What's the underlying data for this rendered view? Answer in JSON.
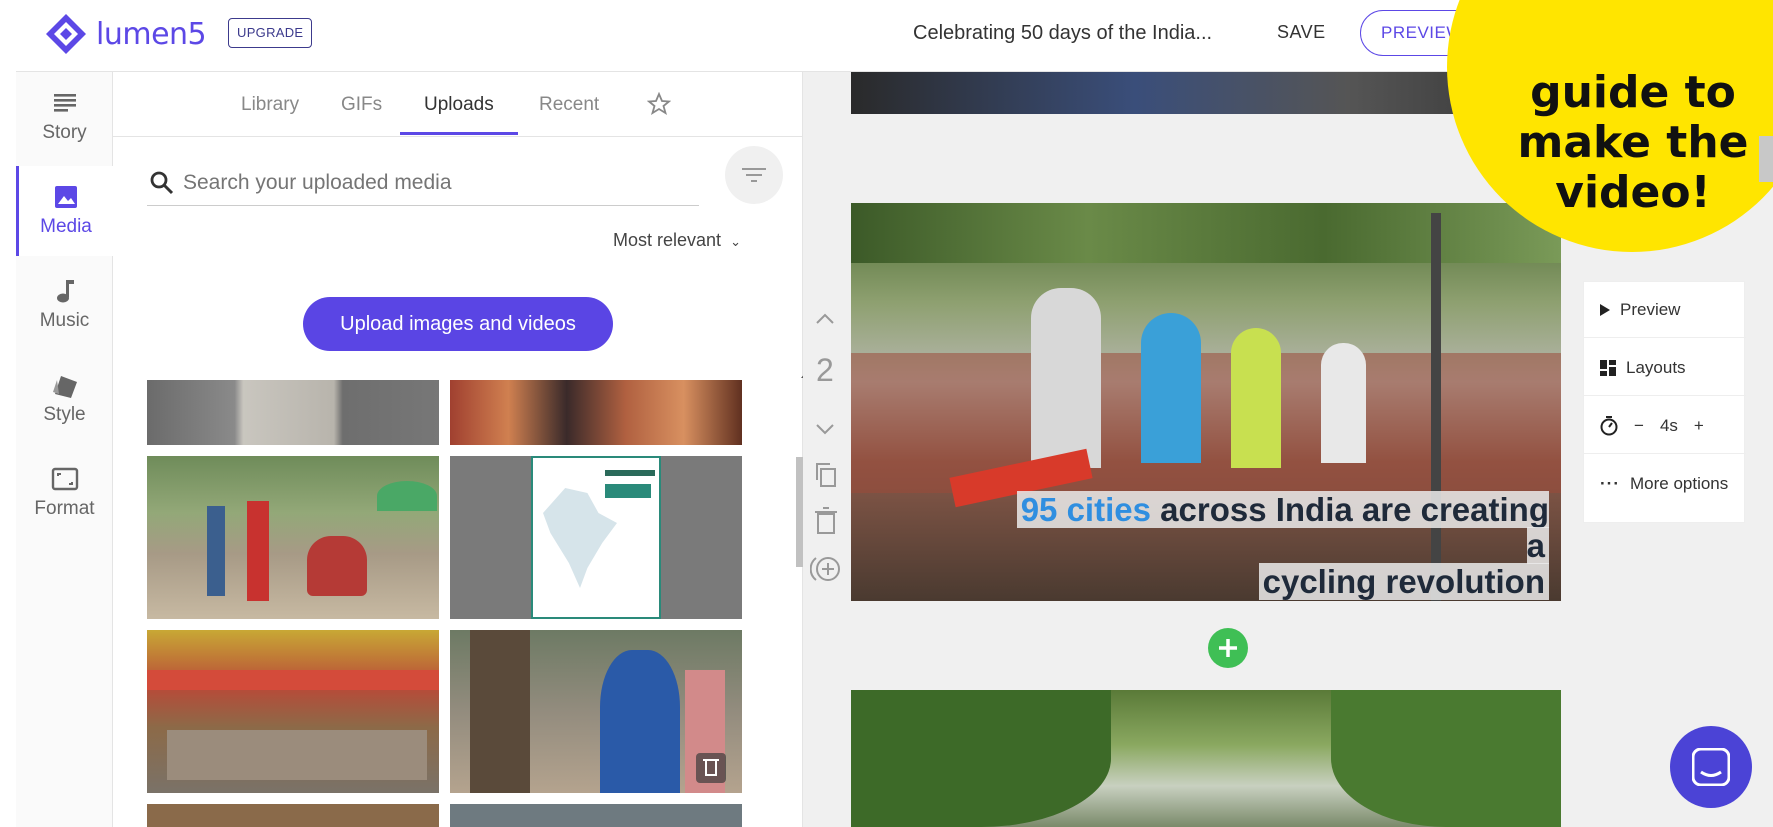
{
  "brand": {
    "name": "lumen5",
    "upgrade_label": "UPGRADE",
    "accent": "#5c48e6"
  },
  "header": {
    "project_title": "Celebrating 50 days of the India...",
    "save_label": "SAVE",
    "preview_label": "PREVIEW"
  },
  "sticker": {
    "text": "guide to make the video!",
    "color": "#ffe500"
  },
  "sidebar": {
    "items": [
      {
        "label": "Story",
        "icon": "story-icon"
      },
      {
        "label": "Media",
        "icon": "image-icon"
      },
      {
        "label": "Music",
        "icon": "music-note-icon"
      },
      {
        "label": "Style",
        "icon": "style-icon"
      },
      {
        "label": "Format",
        "icon": "format-icon"
      }
    ],
    "active": "Media"
  },
  "media": {
    "tabs": [
      "Library",
      "GIFs",
      "Uploads",
      "Recent"
    ],
    "active_tab": "Uploads",
    "search_placeholder": "Search your uploaded media",
    "sort_label": "Most relevant",
    "upload_label": "Upload images and videos",
    "thumbnails": [
      "statue-photo",
      "market-photo",
      "street-pedestrians-photo",
      "india-map-streets-for-people",
      "busy-bazaar-photo",
      "mother-child-photo",
      "street-photo",
      "map-photo"
    ]
  },
  "scene": {
    "number": "2",
    "caption_highlight": "95 cities",
    "caption_rest_line1": "across India are creating a",
    "caption_line2": "cycling revolution",
    "highlight_color": "#2f8ee0"
  },
  "scene_options": {
    "preview_label": "Preview",
    "layouts_label": "Layouts",
    "duration_value": "4s",
    "minus_label": "−",
    "plus_label": "+",
    "more_label": "More options"
  }
}
